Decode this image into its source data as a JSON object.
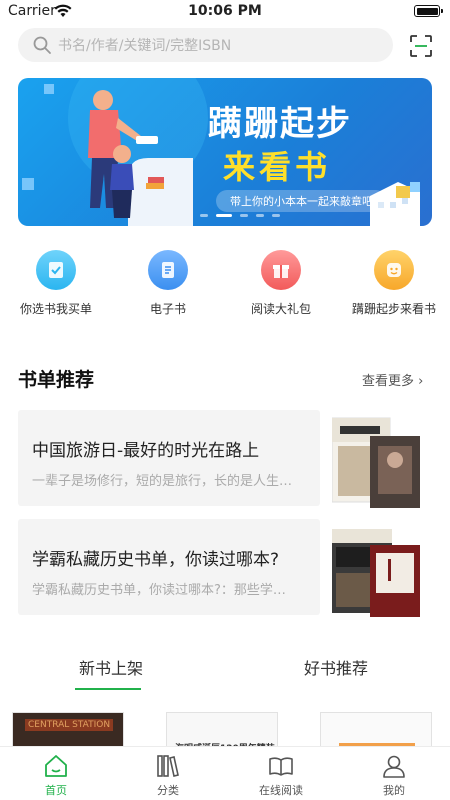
{
  "status_bar": {
    "carrier": "Carrier",
    "time": "10:06 PM"
  },
  "search": {
    "placeholder": "书名/作者/关键词/完整ISBN"
  },
  "banner": {
    "title_line1": "蹒跚起步",
    "title_line2": "来看书",
    "subtitle": "带上你的小本本一起来敲章吧",
    "page_count": 5,
    "active_page": 1
  },
  "quick_actions": [
    {
      "label": "你选书我买单",
      "icon": "check-book-icon",
      "color": "#2bb5f0"
    },
    {
      "label": "电子书",
      "icon": "ebook-icon",
      "color": "#3b8ff0"
    },
    {
      "label": "阅读大礼包",
      "icon": "gift-icon",
      "color": "#f25a5a"
    },
    {
      "label": "蹒跚起步来看书",
      "icon": "smile-face-icon",
      "color": "#f7b52a"
    }
  ],
  "booklist_section": {
    "title": "书单推荐",
    "see_more": "查看更多"
  },
  "booklists": [
    {
      "title": "中国旅游日-最好的时光在路上",
      "subtitle": "一辈子是场修行，短的是旅行，长的是人生…"
    },
    {
      "title": "学霸私藏历史书单，你读过哪本?",
      "subtitle": "学霸私藏历史书单，你读过哪本?：那些学…"
    }
  ],
  "book_tabs": [
    {
      "label": "新书上架",
      "active": true
    },
    {
      "label": "好书推荐",
      "active": false
    }
  ],
  "new_books": [
    {
      "cover_text": "CENTRAL STATION"
    },
    {
      "cover_text": "海明威诞辰120周年精装纪念版"
    },
    {
      "cover_text": ""
    }
  ],
  "tab_bar": [
    {
      "label": "首页",
      "icon": "home-icon",
      "active": true
    },
    {
      "label": "分类",
      "icon": "category-icon",
      "active": false
    },
    {
      "label": "在线阅读",
      "icon": "open-book-icon",
      "active": false
    },
    {
      "label": "我的",
      "icon": "user-icon",
      "active": false
    }
  ],
  "colors": {
    "accent": "#21b14b",
    "banner_blue": "#1b8fe3",
    "banner_yellow": "#ffdf2a"
  }
}
